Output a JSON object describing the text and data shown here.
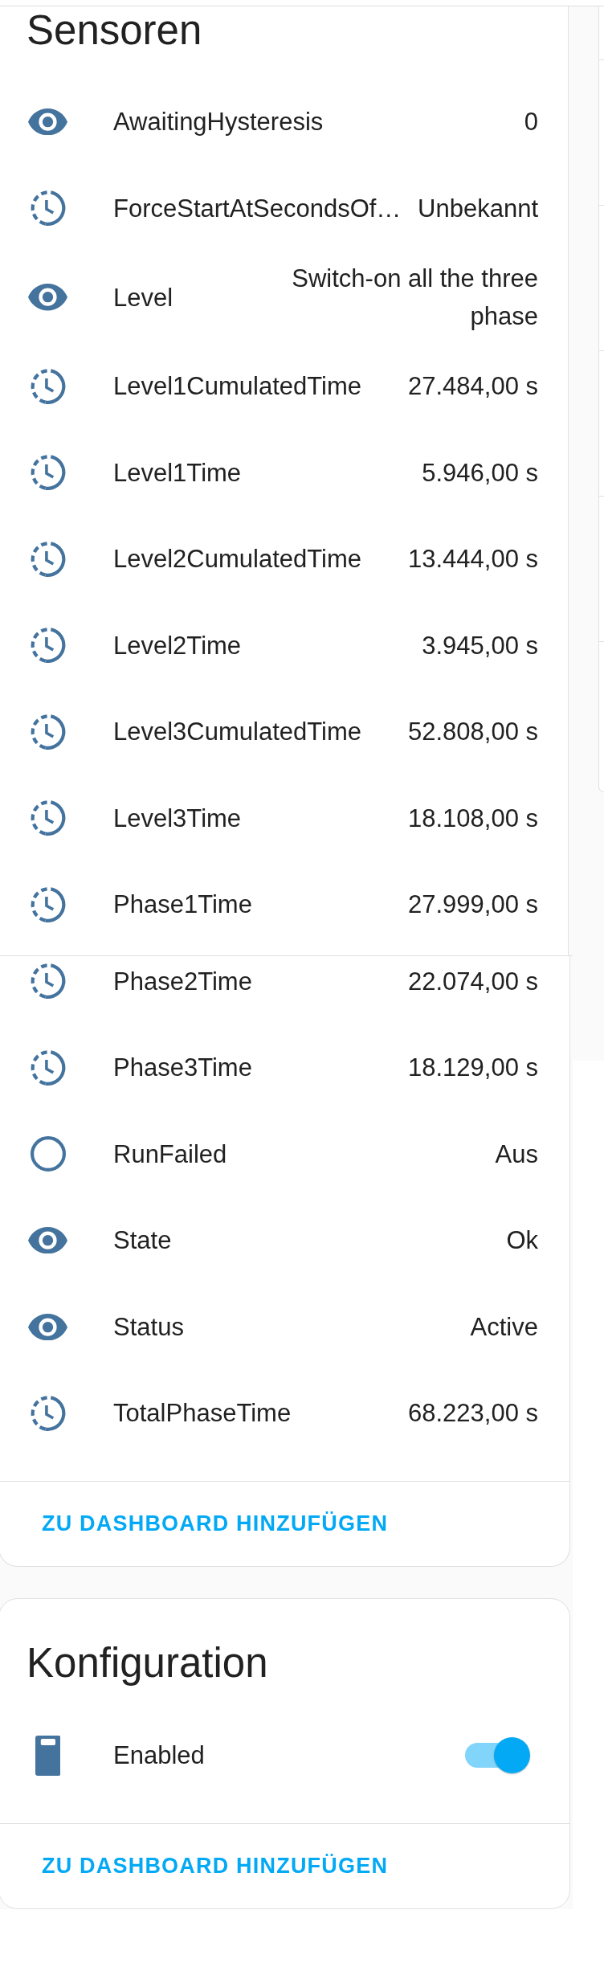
{
  "sensors_card": {
    "title": "Sensoren",
    "entities": [
      {
        "kind": "text",
        "name": "AwaitingHysteresis",
        "value": "0"
      },
      {
        "kind": "duration",
        "name": "ForceStartAtSecondsOf…",
        "value": "Unbekannt"
      },
      {
        "kind": "text",
        "name": "Level",
        "value": "Switch-on all the three phase"
      },
      {
        "kind": "duration",
        "name": "Level1CumulatedTime",
        "value": "27.484,00 s"
      },
      {
        "kind": "duration",
        "name": "Level1Time",
        "value": "5.946,00 s"
      },
      {
        "kind": "duration",
        "name": "Level2CumulatedTime",
        "value": "13.444,00 s"
      },
      {
        "kind": "duration",
        "name": "Level2Time",
        "value": "3.945,00 s"
      },
      {
        "kind": "duration",
        "name": "Level3CumulatedTime",
        "value": "52.808,00 s"
      },
      {
        "kind": "duration",
        "name": "Level3Time",
        "value": "18.108,00 s"
      },
      {
        "kind": "duration",
        "name": "Phase1Time",
        "value": "27.999,00 s"
      }
    ]
  },
  "sensors_card_continued": {
    "entities": [
      {
        "kind": "duration",
        "name": "Phase2Time",
        "value": "22.074,00 s"
      },
      {
        "kind": "duration",
        "name": "Phase3Time",
        "value": "18.129,00 s"
      },
      {
        "kind": "binary",
        "name": "RunFailed",
        "value": "Aus"
      },
      {
        "kind": "text",
        "name": "State",
        "value": "Ok"
      },
      {
        "kind": "text",
        "name": "Status",
        "value": "Active"
      },
      {
        "kind": "duration",
        "name": "TotalPhaseTime",
        "value": "68.223,00 s"
      }
    ],
    "action": "ZU DASHBOARD HINZUFÜGEN"
  },
  "config_card": {
    "title": "Konfiguration",
    "entities": [
      {
        "kind": "switch",
        "name": "Enabled",
        "on": true
      }
    ],
    "action": "ZU DASHBOARD HINZUFÜGEN"
  }
}
